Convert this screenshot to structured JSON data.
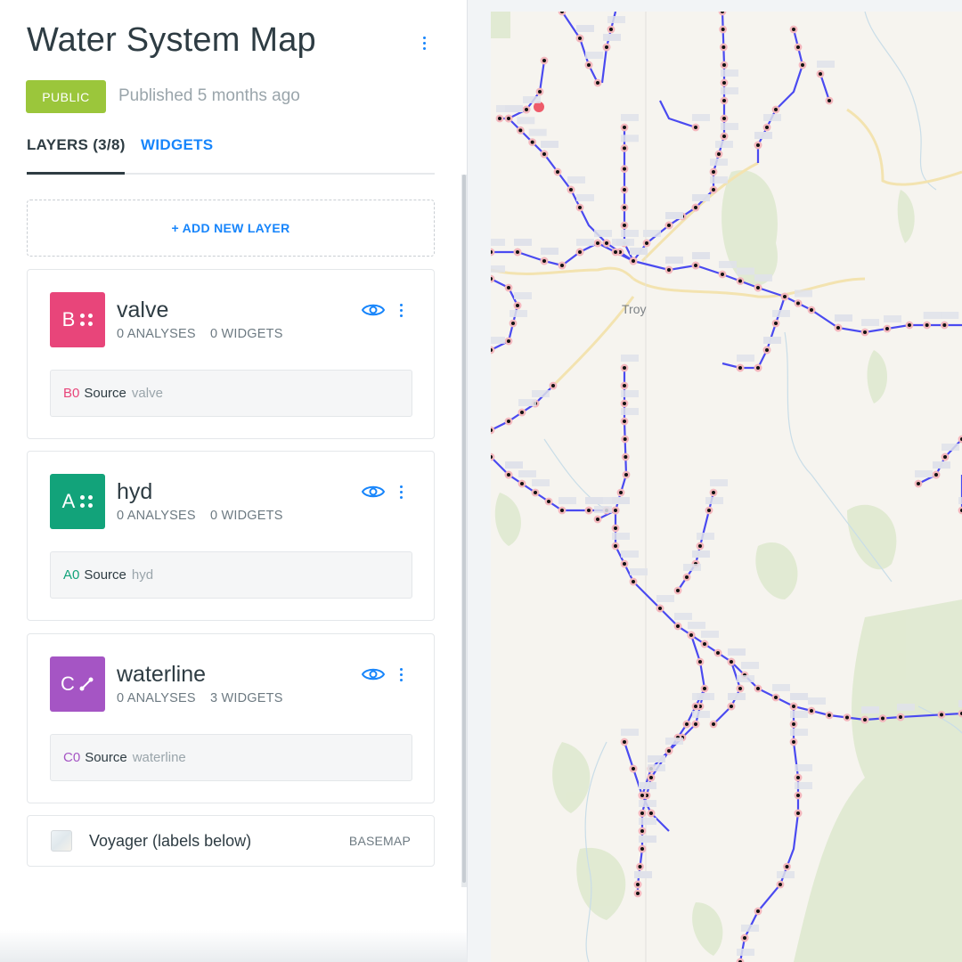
{
  "header": {
    "title": "Water System Map",
    "badge": "PUBLIC",
    "published": "Published 5 months ago"
  },
  "tabs": {
    "layers": "LAYERS (3/8)",
    "widgets": "WIDGETS"
  },
  "add_layer_label": "+ ADD NEW LAYER",
  "layers": [
    {
      "letter": "B",
      "name": "valve",
      "analyses": "0 ANALYSES",
      "widgets": "0 WIDGETS",
      "node": "B0",
      "source_word": "Source",
      "source_name": "valve",
      "color": "#e8457a",
      "icon": "points-icon"
    },
    {
      "letter": "A",
      "name": "hyd",
      "analyses": "0 ANALYSES",
      "widgets": "0 WIDGETS",
      "node": "A0",
      "source_word": "Source",
      "source_name": "hyd",
      "color": "#12a37a",
      "icon": "points-icon"
    },
    {
      "letter": "C",
      "name": "waterline",
      "analyses": "0 ANALYSES",
      "widgets": "3 WIDGETS",
      "node": "C0",
      "source_word": "Source",
      "source_name": "waterline",
      "color": "#a555c4",
      "icon": "line-icon"
    }
  ],
  "basemap": {
    "name": "Voyager (labels below)",
    "tag": "BASEMAP"
  },
  "map": {
    "city_label": "Troy",
    "line_color": "#4a4af0",
    "point_fill": "#111111",
    "point_halo": "#f3b7bd"
  },
  "colors": {
    "accent": "#1785fb",
    "public_badge": "#9bc63b"
  }
}
